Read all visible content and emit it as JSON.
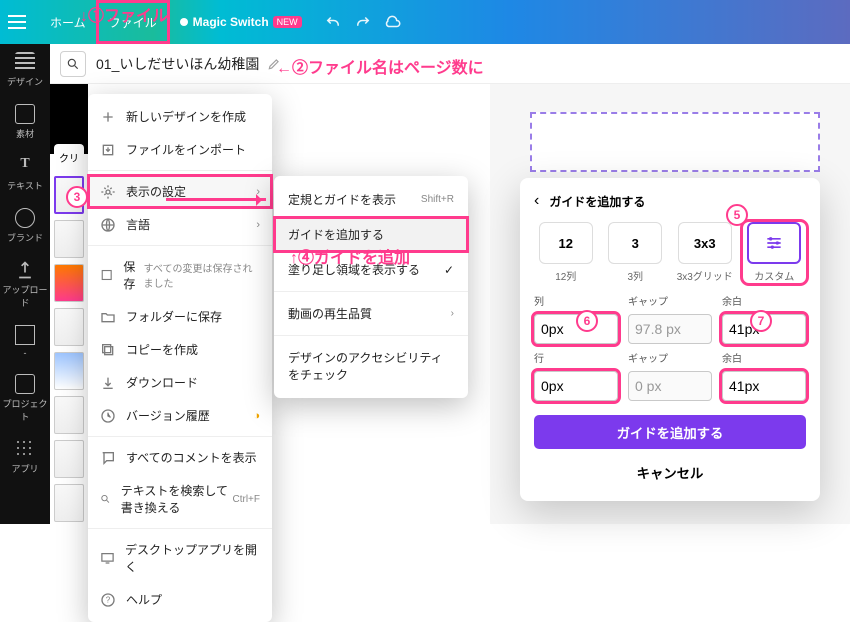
{
  "topbar": {
    "home": "ホーム",
    "file": "ファイル",
    "magic": "Magic Switch",
    "magic_badge": "NEW"
  },
  "leftnav": {
    "items": [
      "デザイン",
      "素材",
      "テキスト",
      "ブランド",
      "アップロード",
      "-",
      "プロジェクト",
      "アプリ"
    ]
  },
  "doc_title": "01_いしだせいほん幼稚園",
  "sidebar_create": "クリ",
  "file_menu": {
    "new_design": "新しいデザインを作成",
    "import": "ファイルをインポート",
    "display": "表示の設定",
    "language": "言語",
    "save": "保存",
    "save_hint": "すべての変更は保存されました",
    "save_to_folder": "フォルダーに保存",
    "make_copy": "コピーを作成",
    "download": "ダウンロード",
    "version_history": "バージョン履歴",
    "show_comments": "すべてのコメントを表示",
    "find_replace": "テキストを検索して書き換える",
    "find_shortcut": "Ctrl+F",
    "open_desktop": "デスクトップアプリを開く",
    "help": "ヘルプ"
  },
  "submenu": {
    "show_ruler": "定規とガイドを表示",
    "ruler_shortcut": "Shift+R",
    "add_guide": "ガイドを追加する",
    "show_bleed": "塗り足し領域を表示する",
    "quality": "動画の再生品質",
    "a11y": "デザインのアクセシビリティをチェック"
  },
  "guide_panel": {
    "title": "ガイドを追加する",
    "presets": [
      {
        "box": "12",
        "label": "12列"
      },
      {
        "box": "3",
        "label": "3列"
      },
      {
        "box": "3x3",
        "label": "3x3グリッド"
      },
      {
        "box": "⚙",
        "label": "カスタム"
      }
    ],
    "labels": {
      "columns": "列",
      "gap": "ギャップ",
      "margin": "余白",
      "rows": "行"
    },
    "values": {
      "columns": "0px",
      "gap1": "97.8 px",
      "margin1": "41px",
      "rows": "0px",
      "gap2": "0 px",
      "margin2": "41px"
    },
    "add_button": "ガイドを追加する",
    "cancel": "キャンセル"
  },
  "annotations": {
    "a1": "↓①ファイル",
    "a2": "←②ファイル名はページ数に",
    "a3": "③",
    "a4": "↑④ガイドを追加",
    "a5": "⑤",
    "a6": "⑥",
    "a7": "⑦"
  }
}
